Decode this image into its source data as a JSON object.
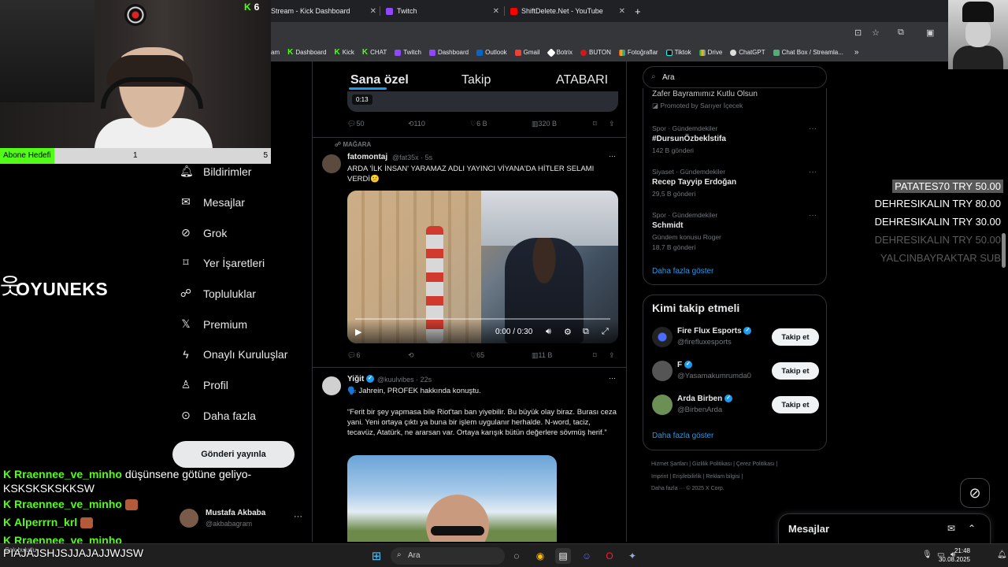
{
  "browser": {
    "tabs": [
      {
        "title": "Stream - Kick Dashboard",
        "color": "#53fc18"
      },
      {
        "title": "Twitch",
        "color": "#9146ff"
      },
      {
        "title": "ShiftDelete.Net - YouTube",
        "color": "#ff0000"
      }
    ],
    "new_tab": "+",
    "bookmarks": [
      {
        "label": "Dashboard",
        "kind": "kick"
      },
      {
        "label": "Kick",
        "kind": "kick"
      },
      {
        "label": "CHAT",
        "kind": "kick"
      },
      {
        "label": "Twitch",
        "kind": "twitch"
      },
      {
        "label": "Dashboard",
        "kind": "twitch"
      },
      {
        "label": "Outlook",
        "kind": "outlook"
      },
      {
        "label": "Gmail",
        "kind": "gmail"
      },
      {
        "label": "Botrix",
        "kind": "botrix"
      },
      {
        "label": "BUTON",
        "kind": "buton"
      },
      {
        "label": "Fotoğraflar",
        "kind": "photos"
      },
      {
        "label": "Tiktok",
        "kind": "tiktok"
      },
      {
        "label": "Drive",
        "kind": "drive"
      },
      {
        "label": "ChatGPT",
        "kind": "chatgpt"
      },
      {
        "label": "Chat Box / Streamla...",
        "kind": "chatbox"
      }
    ],
    "bookmarks_prefix": "am"
  },
  "nav": {
    "items": [
      {
        "label": "Bildirimler",
        "icon": "bell-icon"
      },
      {
        "label": "Mesajlar",
        "icon": "envelope-icon"
      },
      {
        "label": "Grok",
        "icon": "grok-icon"
      },
      {
        "label": "Yer İşaretleri",
        "icon": "bookmark-icon"
      },
      {
        "label": "Topluluklar",
        "icon": "communities-icon"
      },
      {
        "label": "Premium",
        "icon": "x-logo-icon"
      },
      {
        "label": "Onaylı Kuruluşlar",
        "icon": "lightning-icon"
      },
      {
        "label": "Profil",
        "icon": "person-icon"
      },
      {
        "label": "Daha fazla",
        "icon": "more-circle-icon"
      }
    ],
    "post_button": "Gönderi yayınla",
    "account": {
      "name": "Mustafa Akbaba",
      "handle": "@akbabagram"
    }
  },
  "feed": {
    "tabs": [
      "Sana özel",
      "Takip",
      "ATABARI"
    ],
    "top_video_time": "0:13",
    "post1_actions": {
      "replies": "50",
      "reposts": "110",
      "likes": "6 B",
      "views": "320 B"
    },
    "post2": {
      "community": "MAĞARA",
      "name": "fatomontaj",
      "handle_time": "@fat35x · 5s",
      "text": "ARDA 'İLK İNSAN' YARAMAZ ADLI YAYINCI VİYANA'DA HİTLER SELAMI VERDİ😕",
      "video_time": "0:00 / 0:30",
      "actions": {
        "replies": "6",
        "reposts": "",
        "likes": "65",
        "views": "11 B"
      }
    },
    "post3": {
      "name": "Yiğit",
      "handle_time": "@kuulvibes · 22s",
      "line1": "🗣️ Jahrein, PROFEK hakkında konuştu.",
      "quote": "“Ferit bir şey yapmasa bile Riot'tan ban yiyebilir. Bu büyük olay biraz. Burası ceza yani. Yeni ortaya çıktı ya buna bir işlem uygulanır herhalde. N-word, taciz, tecavüz, Atatürk, ne ararsan var. Ortaya karışık bütün değerlere sövmüş herif.”"
    }
  },
  "right": {
    "search_value": "Ara",
    "trends": [
      {
        "meta": "",
        "title": "Zafer Bayramımız Kutlu Olsun",
        "sub": "Promoted by Sarıyer İçecek"
      },
      {
        "meta": "Spor · Gündemdekiler",
        "title": "#DursunÖzbekİstifa",
        "sub": "142 B gönderi"
      },
      {
        "meta": "Siyaset · Gündemdekiler",
        "title": "Recep Tayyip Erdoğan",
        "sub": "29,5 B gönderi"
      },
      {
        "meta": "Spor · Gündemdekiler",
        "title": "Schmidt",
        "sub": "Gündem konusu Roger",
        "sub2": "18,7 B gönderi"
      }
    ],
    "show_more": "Daha fazla göster",
    "who_to_follow": "Kimi takip etmeli",
    "follow_label": "Takip et",
    "suggestions": [
      {
        "name": "Fire Flux Esports",
        "handle": "@firefluxesports"
      },
      {
        "name": "F",
        "handle": "@Yasamakumrumda0"
      },
      {
        "name": "Arda Birben",
        "handle": "@BirbenArda"
      }
    ],
    "show_more2": "Daha fazla göster",
    "footer1": "Hizmet Şartları  |  Gizlilik Politikası  |  Çerez Politikası  |",
    "footer2": "Imprint  |  Erişilebilirlik  |  Reklam bilgisi  |",
    "footer3": "Daha fazla ···   © 2025 X Corp.",
    "messages": "Mesajlar"
  },
  "stream": {
    "viewer_count": "6",
    "sub_goal": {
      "label": "Abone Hedefi",
      "current": "1",
      "max": "5",
      "progress": 0.2
    },
    "brand": "OYUNEKS",
    "donations": [
      {
        "text": "PATATES70   TRY 50.00",
        "style": "hl"
      },
      {
        "text": "DEHRESIKALIN   TRY 80.00",
        "style": ""
      },
      {
        "text": "DEHRESIKALIN   TRY 30.00",
        "style": ""
      },
      {
        "text": "DEHRESIKALIN   TRY 50.00",
        "style": "dim"
      },
      {
        "text": "YALCINBAYRAKTAR   SUB",
        "style": "dim"
      }
    ],
    "chat": [
      {
        "user": "Rraennee_ve_minho",
        "msg": "düşünsene götüne geliyo-"
      },
      {
        "user": "",
        "msg": "KSKSKSKSKKSW"
      },
      {
        "user": "Rraennee_ve_minho",
        "msg": ""
      },
      {
        "user": "Alperrrn_krl",
        "msg": ""
      },
      {
        "user": "Rraennee_ve_minho",
        "msg": ""
      },
      {
        "user": "",
        "msg": "PIAJAJSHJSJJAJAJJWJSW"
      }
    ]
  },
  "taskbar": {
    "search": "Ara",
    "time": "21:48",
    "date": "30.08.2025",
    "weather": "Çok bulutlu"
  }
}
